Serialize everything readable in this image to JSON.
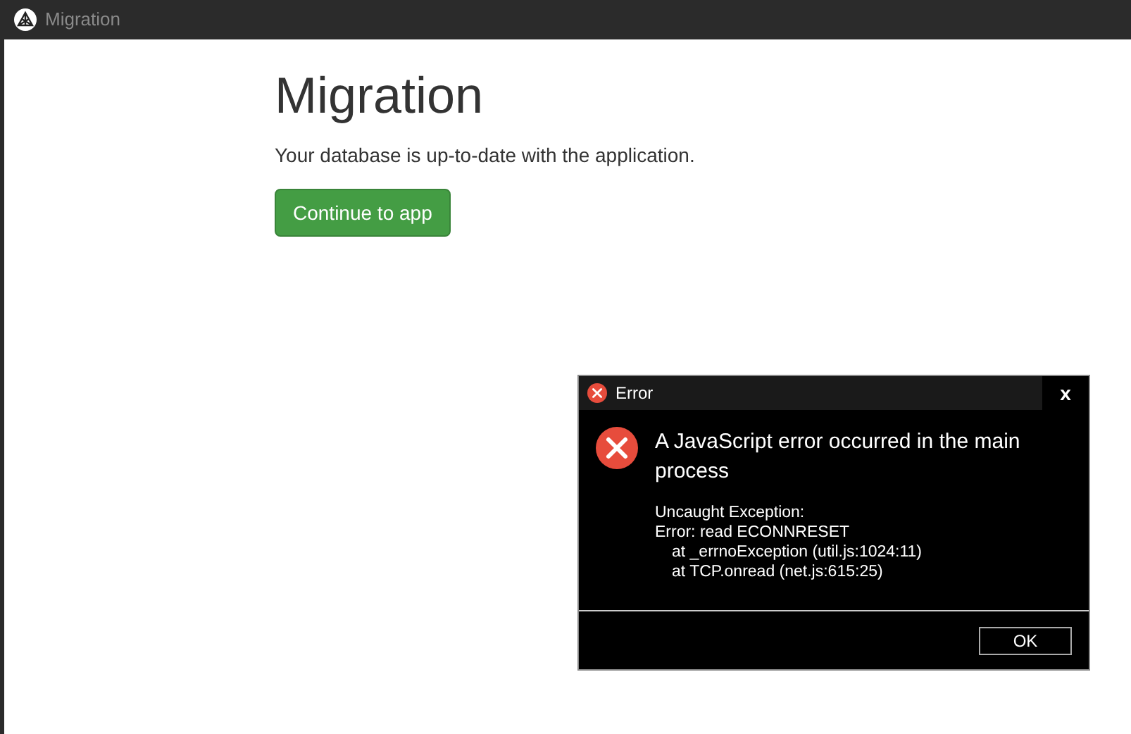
{
  "window": {
    "title": "Migration"
  },
  "page": {
    "heading": "Migration",
    "message": "Your database is up-to-date with the application.",
    "button": "Continue to app"
  },
  "dialog": {
    "title": "Error",
    "close": "x",
    "headline": "A JavaScript error occurred in the main process",
    "details": [
      {
        "text": "Uncaught Exception:",
        "indented": false
      },
      {
        "text": "Error: read ECONNRESET",
        "indented": false
      },
      {
        "text": "at _errnoException (util.js:1024:11)",
        "indented": true
      },
      {
        "text": "at TCP.onread (net.js:615:25)",
        "indented": true
      }
    ],
    "button": "OK"
  }
}
